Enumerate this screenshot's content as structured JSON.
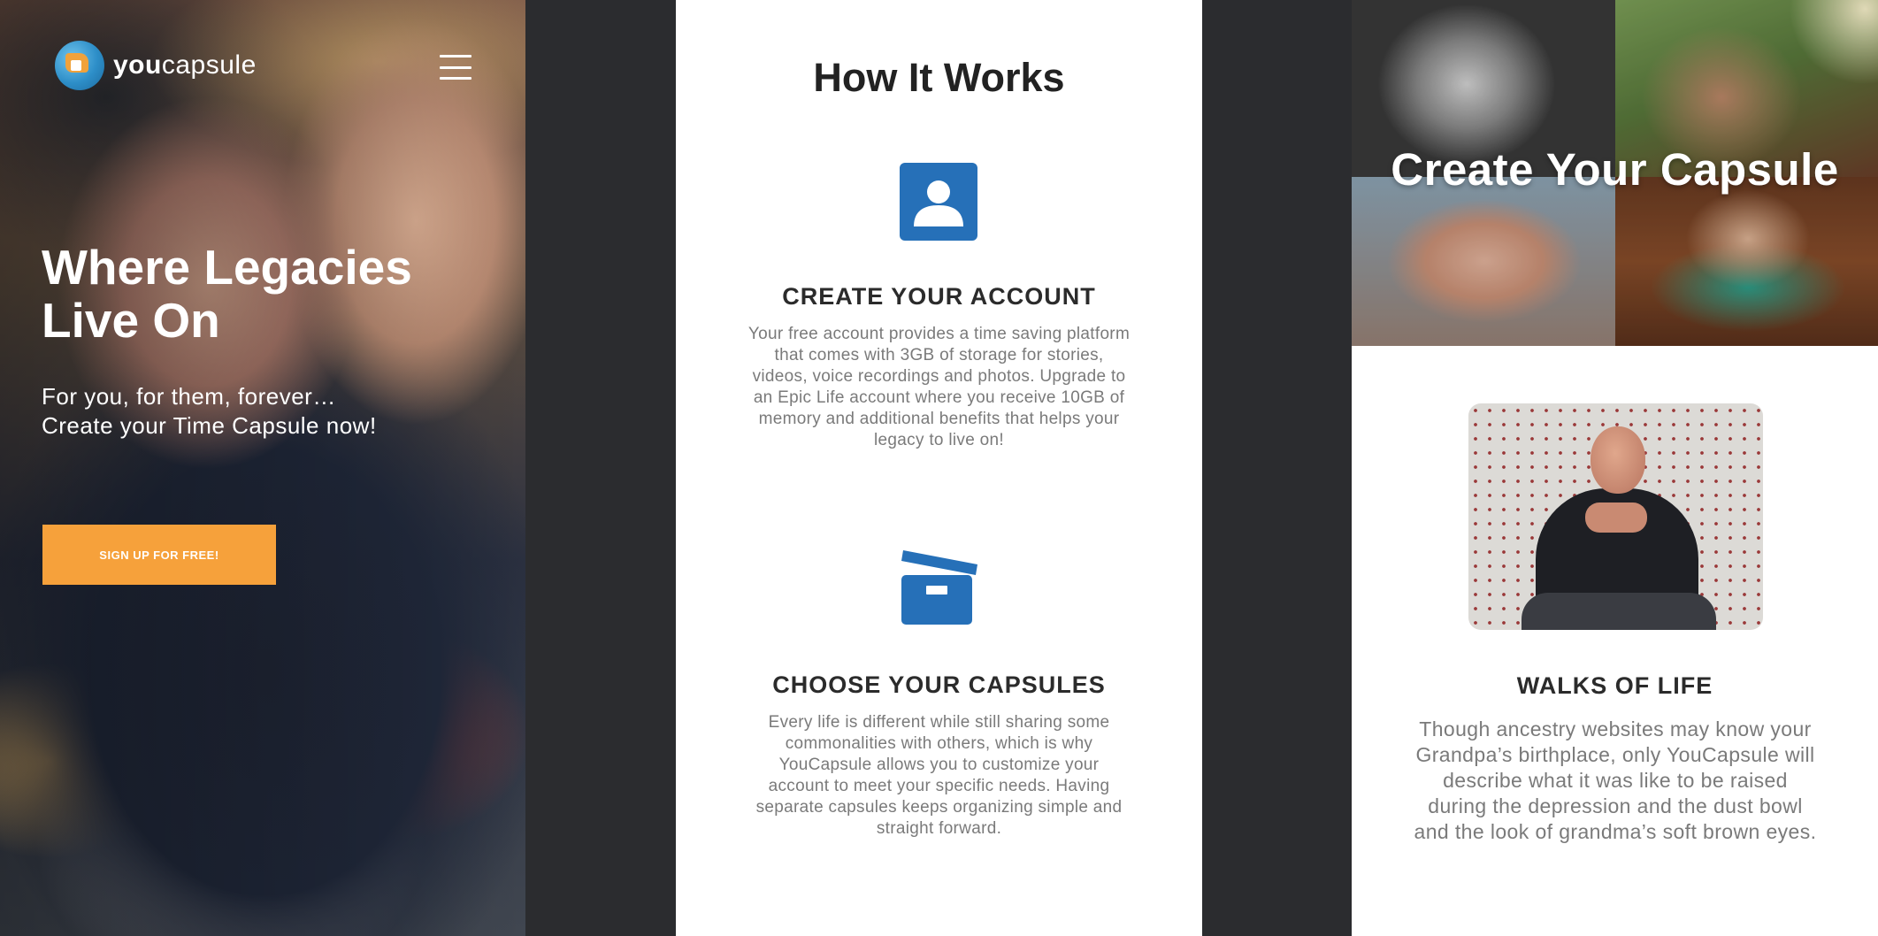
{
  "brand": {
    "name_bold": "you",
    "name_light": "capsule"
  },
  "hero": {
    "title_line1": "Where Legacies",
    "title_line2": "Live On",
    "subtitle_line1": "For you, for them, forever…",
    "subtitle_line2": "Create your Time Capsule now!",
    "cta_label": "SIGN UP FOR FREE!"
  },
  "how_it_works": {
    "title": "How It Works",
    "steps": [
      {
        "icon": "user-account-icon",
        "title": "CREATE YOUR ACCOUNT",
        "text": "Your free account provides a time saving platform that comes with 3GB of storage for stories, videos, voice recordings and photos. Upgrade to an Epic Life account where you receive 10GB of memory and additional benefits that helps your legacy to live on!"
      },
      {
        "icon": "archive-box-icon",
        "title": "CHOOSE YOUR CAPSULES",
        "text": "Every life is different while still sharing some commonalities with others, which is why YouCapsule allows you to customize your account to meet your specific needs. Having separate capsules keeps organizing simple and straight forward."
      }
    ]
  },
  "capsule": {
    "title": "Create Your Capsule",
    "section_title": "WALKS OF LIFE",
    "section_text": "Though ancestry websites may know your Grandpa’s birthplace, only YouCapsule will describe what it was like to be raised during the depression and the dust bowl and the look of grandma’s soft brown eyes."
  },
  "colors": {
    "accent_orange": "#f6a13b",
    "icon_blue": "#2670b8",
    "dark_bg": "#2b2c2f"
  }
}
